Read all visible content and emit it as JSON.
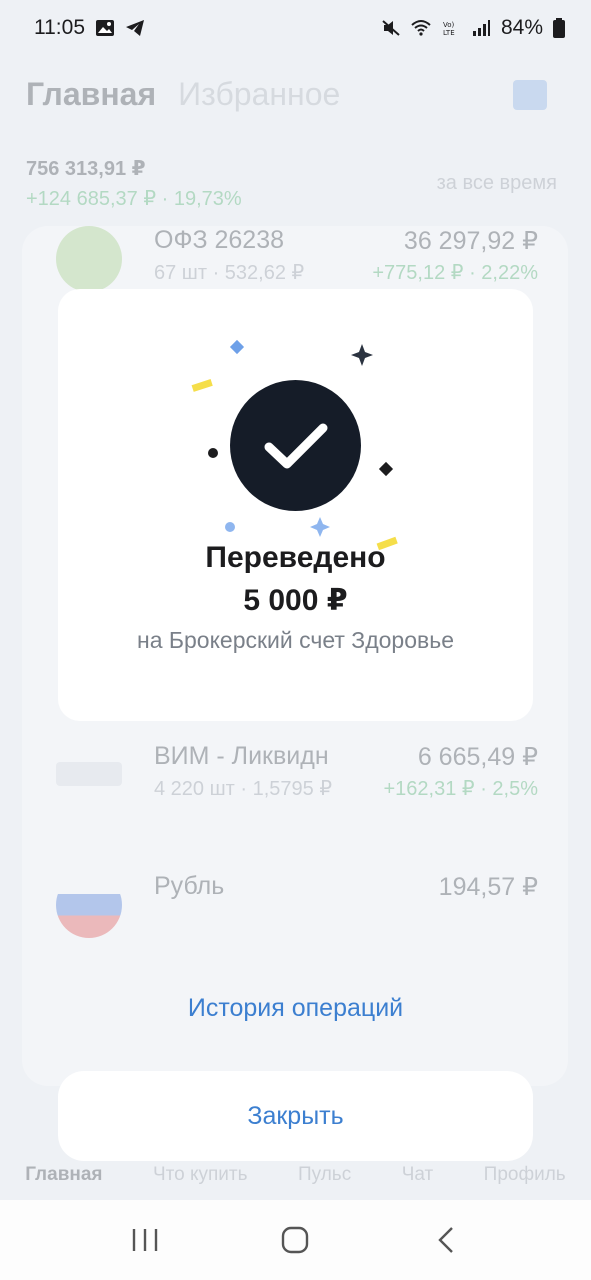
{
  "status_bar": {
    "time": "11:05",
    "battery": "84%",
    "icons": [
      "gallery-icon",
      "telegram-icon",
      "mute-icon",
      "wifi-icon",
      "volte-icon",
      "signal-icon",
      "battery-icon"
    ]
  },
  "background": {
    "tabs": [
      "Главная",
      "Избранное"
    ],
    "portfolio_total": "756 313,91 ₽",
    "portfolio_change": "+124 685,37 ₽ · 19,73%",
    "period": "за все время",
    "rows": [
      {
        "name": "ОФЗ 26238",
        "sub": "67 шт · 532,62 ₽",
        "value": "36 297,92 ₽",
        "change": "+775,12 ₽ · 2,22%"
      },
      {
        "name": "ВИМ - Ликвидн",
        "sub": "4 220 шт · 1,5795 ₽",
        "value": "6 665,49 ₽",
        "change": "+162,31 ₽ · 2,5%"
      },
      {
        "name": "Рубль",
        "sub": "",
        "value": "194,57 ₽",
        "change": ""
      }
    ],
    "bottom_nav": [
      "Главная",
      "Что купить",
      "Пульс",
      "Чат",
      "Профиль"
    ]
  },
  "dialog": {
    "title": "Переведено",
    "amount": "5 000 ₽",
    "subtitle": "на Брокерский счет Здоровье",
    "colors": {
      "check_bg": "#151c28",
      "confetti_blue": "#6ea0e8",
      "confetti_yellow": "#f5de4a",
      "confetti_dark": "#2b3340"
    }
  },
  "actions": {
    "history": "История операций",
    "close": "Закрыть"
  },
  "system_nav": {
    "icons": [
      "recent-apps-icon",
      "home-icon",
      "back-icon"
    ]
  }
}
